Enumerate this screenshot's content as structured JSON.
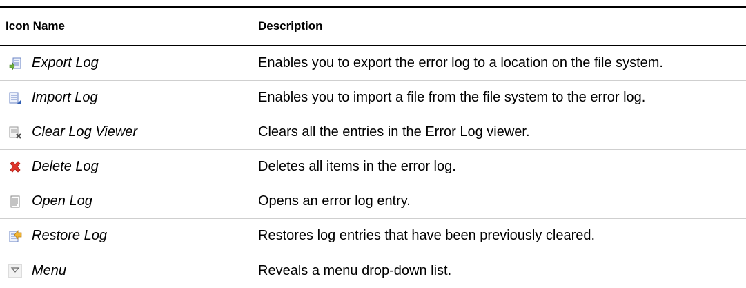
{
  "table": {
    "headers": {
      "icon_name": "Icon Name",
      "description": "Description"
    },
    "rows": [
      {
        "icon": "export-log-icon",
        "name": "Export Log",
        "description": "Enables you to export the error log to a location on the file system."
      },
      {
        "icon": "import-log-icon",
        "name": "Import Log",
        "description": "Enables you to import a file from the file system to the error log."
      },
      {
        "icon": "clear-log-viewer-icon",
        "name": "Clear Log Viewer",
        "description": "Clears all the entries in the Error Log viewer."
      },
      {
        "icon": "delete-log-icon",
        "name": "Delete Log",
        "description": "Deletes all items in the error log."
      },
      {
        "icon": "open-log-icon",
        "name": "Open Log",
        "description": "Opens an error log entry."
      },
      {
        "icon": "restore-log-icon",
        "name": "Restore Log",
        "description": "Restores log entries that have been previously cleared."
      },
      {
        "icon": "menu-icon",
        "name": "Menu",
        "description": "Reveals a menu drop-down list."
      }
    ]
  }
}
